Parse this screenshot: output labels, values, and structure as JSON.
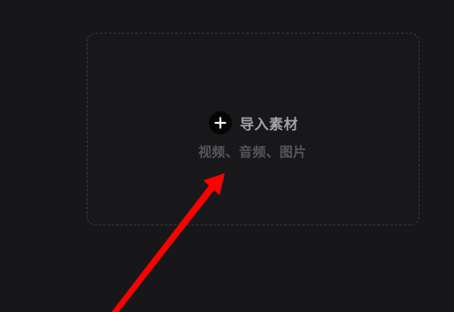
{
  "import_panel": {
    "label": "导入素材",
    "hint": "视频、音频、图片",
    "icon": "plus-icon"
  },
  "annotation": {
    "icon": "red-arrow-icon",
    "color": "#ff0000"
  },
  "colors": {
    "background": "#17171a",
    "panel_border": "#38383c",
    "label": "#a3a3a7",
    "hint": "#56565b"
  }
}
